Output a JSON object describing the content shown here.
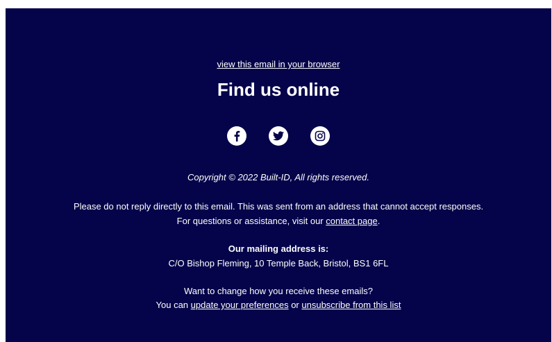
{
  "browser_link": "view this email in your browser",
  "heading": "Find us online",
  "social": [
    {
      "name": "facebook"
    },
    {
      "name": "twitter"
    },
    {
      "name": "instagram"
    }
  ],
  "copyright": "Copyright © 2022 Built-ID, All rights reserved.",
  "notice": {
    "line1": "Please do not reply directly to this email. This was sent from an address that cannot accept responses.",
    "line2_prefix": "For questions or assistance, visit our ",
    "line2_link": "contact page",
    "line2_suffix": "."
  },
  "mailing": {
    "label": "Our mailing address is:",
    "address": "C/O Bishop Fleming, 10 Temple Back, Bristol, BS1 6FL"
  },
  "preferences": {
    "question": "Want to change how you receive these emails?",
    "prefix": "You can ",
    "update_link": "update your preferences",
    "middle": " or ",
    "unsubscribe_link": "unsubscribe from this list"
  },
  "colors": {
    "background": "#05044a",
    "text": "#ffffff"
  }
}
